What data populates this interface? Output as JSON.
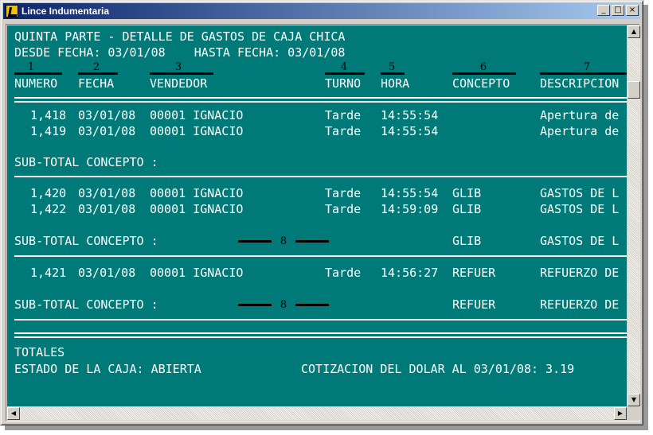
{
  "window": {
    "title": "Lince Indumentaria"
  },
  "title_buttons": {
    "minimize": "_",
    "maximize": "□",
    "close": "×"
  },
  "report": {
    "title": "QUINTA PARTE - DETALLE DE GASTOS DE CAJA CHICA",
    "date_range": "DESDE FECHA: 03/01/08    HASTA FECHA: 03/01/08",
    "col_numbers": [
      "1",
      "2",
      "3",
      "4",
      "5",
      "6",
      "7"
    ],
    "headers": {
      "numero": "NUMERO",
      "fecha": "FECHA",
      "vendedor": "VENDEDOR",
      "turno": "TURNO",
      "hora": "HORA",
      "concepto": "CONCEPTO",
      "descripcion": "DESCRIPCION"
    },
    "rows": [
      {
        "numero": "1,418",
        "fecha": "03/01/08",
        "vendedor": "00001 IGNACIO",
        "turno": "Tarde",
        "hora": "14:55:54",
        "concepto": "",
        "descripcion": "Apertura de"
      },
      {
        "numero": "1,419",
        "fecha": "03/01/08",
        "vendedor": "00001 IGNACIO",
        "turno": "Tarde",
        "hora": "14:55:54",
        "concepto": "",
        "descripcion": "Apertura de"
      },
      {
        "numero": "1,420",
        "fecha": "03/01/08",
        "vendedor": "00001 IGNACIO",
        "turno": "Tarde",
        "hora": "14:55:54",
        "concepto": "GLIB",
        "descripcion": "GASTOS DE L"
      },
      {
        "numero": "1,422",
        "fecha": "03/01/08",
        "vendedor": "00001 IGNACIO",
        "turno": "Tarde",
        "hora": "14:59:09",
        "concepto": "GLIB",
        "descripcion": "GASTOS DE L"
      },
      {
        "numero": "1,421",
        "fecha": "03/01/08",
        "vendedor": "00001 IGNACIO",
        "turno": "Tarde",
        "hora": "14:56:27",
        "concepto": "REFUER",
        "descripcion": "REFUERZO DE"
      }
    ],
    "subtotals": [
      {
        "label": "SUB-TOTAL CONCEPTO :",
        "marker": "",
        "concepto": "",
        "descripcion": ""
      },
      {
        "label": "SUB-TOTAL CONCEPTO :",
        "marker": "8",
        "concepto": "GLIB",
        "descripcion": "GASTOS DE L"
      },
      {
        "label": "SUB-TOTAL CONCEPTO :",
        "marker": "8",
        "concepto": "REFUER",
        "descripcion": "REFUERZO DE"
      }
    ],
    "totales_label": "TOTALES",
    "estado_caja": "ESTADO DE LA CAJA: ABIERTA",
    "cotizacion": "COTIZACION DEL DOLAR AL 03/01/08: 3.19"
  },
  "scrollbars": {
    "up": "▲",
    "down": "▼",
    "left": "◀",
    "right": "▶"
  },
  "colors": {
    "screen_bg": "#007a78",
    "text": "#ffffff",
    "titlebar_start": "#0a246a",
    "titlebar_end": "#a6caf0"
  }
}
